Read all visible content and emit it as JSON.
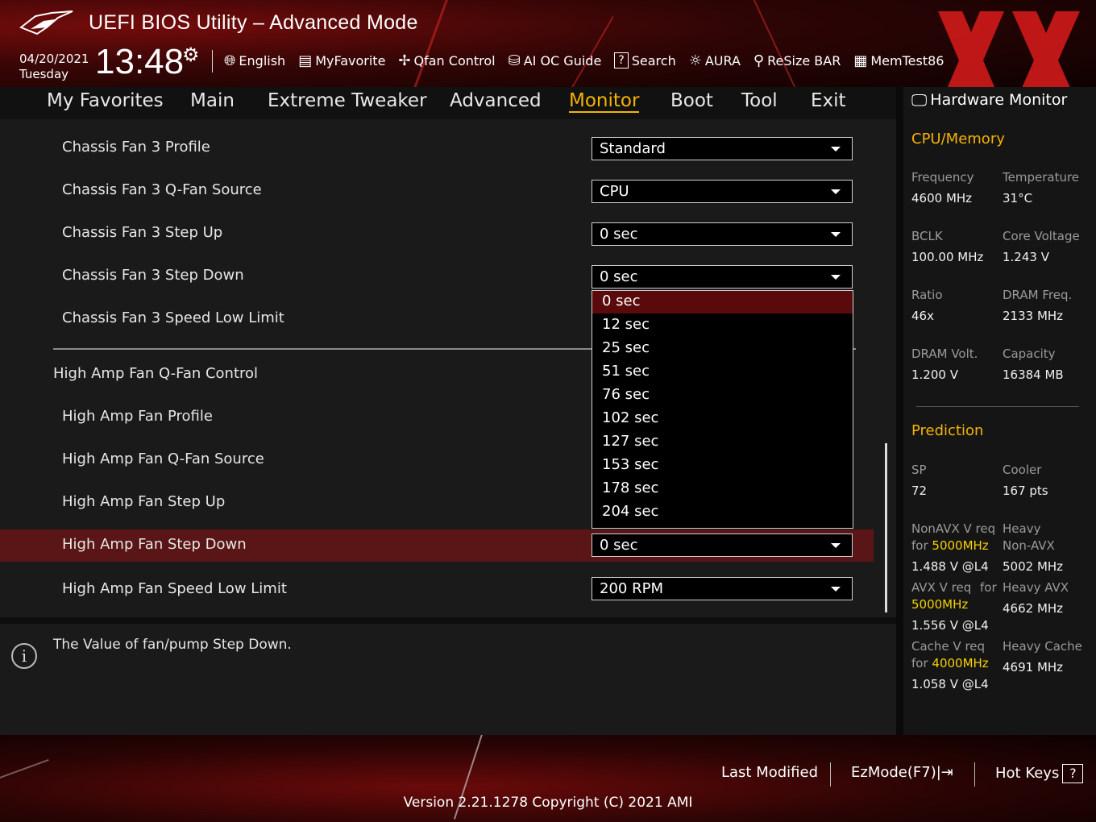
{
  "header": {
    "title": "UEFI BIOS Utility – Advanced Mode",
    "date": "04/20/2021",
    "day": "Tuesday",
    "time": "13:48",
    "tools": [
      {
        "icon": "globe-icon",
        "label": "English"
      },
      {
        "icon": "myfavorite-icon",
        "label": "MyFavorite"
      },
      {
        "icon": "fan-icon",
        "label": "Qfan Control"
      },
      {
        "icon": "ai-chip-icon",
        "label": "AI OC Guide"
      },
      {
        "icon": "search-icon",
        "label": "Search"
      },
      {
        "icon": "aura-icon",
        "label": "AURA"
      },
      {
        "icon": "resize-bar-icon",
        "label": "ReSize BAR"
      },
      {
        "icon": "memtest-icon",
        "label": "MemTest86"
      }
    ]
  },
  "nav": {
    "tabs": [
      "My Favorites",
      "Main",
      "Extreme Tweaker",
      "Advanced",
      "Monitor",
      "Boot",
      "Tool",
      "Exit"
    ],
    "active": "Monitor"
  },
  "settings": {
    "rows": [
      {
        "label": "Chassis Fan 3 Profile",
        "value": "Standard"
      },
      {
        "label": "Chassis Fan 3 Q-Fan Source",
        "value": "CPU"
      },
      {
        "label": "Chassis Fan 3 Step Up",
        "value": "0 sec"
      },
      {
        "label": "Chassis Fan 3 Step Down",
        "value": "0 sec"
      },
      {
        "label": "Chassis Fan 3 Speed Low Limit",
        "value": ""
      },
      {
        "label": "High Amp Fan Q-Fan Control",
        "value": ""
      },
      {
        "label": "High Amp Fan Profile",
        "value": ""
      },
      {
        "label": "High Amp Fan Q-Fan Source",
        "value": ""
      },
      {
        "label": "High Amp Fan Step Up",
        "value": ""
      },
      {
        "label": "High Amp Fan Step Down",
        "value": "0 sec"
      },
      {
        "label": "High Amp Fan Speed Low Limit",
        "value": "200 RPM"
      }
    ],
    "selected_row": "High Amp Fan Step Down"
  },
  "dropdown": {
    "options": [
      "0 sec",
      "12 sec",
      "25 sec",
      "51 sec",
      "76 sec",
      "102 sec",
      "127 sec",
      "153 sec",
      "178 sec",
      "204 sec"
    ],
    "selected": "0 sec"
  },
  "help": {
    "text": "The Value of fan/pump Step Down."
  },
  "hardware_monitor": {
    "title": "Hardware Monitor",
    "cpu_memory": {
      "heading": "CPU/Memory",
      "items": [
        {
          "label": "Frequency",
          "value": "4600 MHz"
        },
        {
          "label": "Temperature",
          "value": "31°C"
        },
        {
          "label": "BCLK",
          "value": "100.00 MHz"
        },
        {
          "label": "Core Voltage",
          "value": "1.243 V"
        },
        {
          "label": "Ratio",
          "value": "46x"
        },
        {
          "label": "DRAM Freq.",
          "value": "2133 MHz"
        },
        {
          "label": "DRAM Volt.",
          "value": "1.200 V"
        },
        {
          "label": "Capacity",
          "value": "16384 MB"
        }
      ]
    },
    "prediction": {
      "heading": "Prediction",
      "sp_label": "SP",
      "sp_value": "72",
      "cooler_label": "Cooler",
      "cooler_value": "167 pts",
      "nonavx_label": "NonAVX V req",
      "nonavx_for": "for",
      "nonavx_freq": "5000MHz",
      "nonavx_value": "1.488 V @L4",
      "heavy_nonavx_label1": "Heavy",
      "heavy_nonavx_label2": "Non-AVX",
      "heavy_nonavx_value": "5002 MHz",
      "avx_label": "AVX V req",
      "avx_for": "for",
      "avx_freq": "5000MHz",
      "avx_value": "1.556 V @L4",
      "heavy_avx_label": "Heavy AVX",
      "heavy_avx_value": "4662 MHz",
      "cache_label": "Cache V req",
      "cache_for": "for",
      "cache_freq": "4000MHz",
      "cache_value": "1.058 V @L4",
      "heavy_cache_label": "Heavy Cache",
      "heavy_cache_value": "4691 MHz"
    }
  },
  "footer": {
    "last_modified": "Last Modified",
    "ezmode": "EzMode(F7)|",
    "hotkeys": "Hot Keys",
    "hotkeys_badge": "?",
    "version": "Version 2.21.1278 Copyright (C) 2021 AMI"
  },
  "colors": {
    "accent": "#f5b300",
    "selected_row": "#5a1616",
    "header_red": "#7a0c0c"
  }
}
